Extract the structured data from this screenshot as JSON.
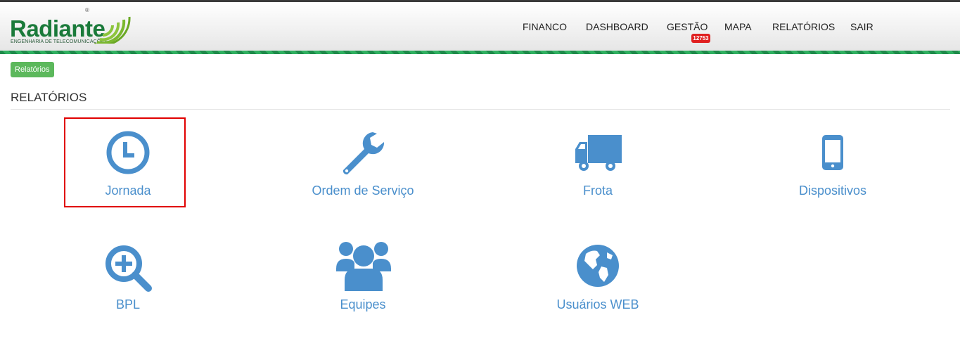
{
  "brand": {
    "name": "Radiante",
    "subtitle": "ENGENHARIA DE TELECOMUNICAÇÕES",
    "registered": "®",
    "color": "#1a7a3a"
  },
  "nav": {
    "items": [
      {
        "label": "FINANCO"
      },
      {
        "label": "DASHBOARD"
      },
      {
        "label": "GESTÃO",
        "badge": "12753"
      },
      {
        "label": "MAPA"
      },
      {
        "label": "RELATÓRIOS"
      },
      {
        "label": "SAIR"
      }
    ]
  },
  "breadcrumb": {
    "label": "Relatórios"
  },
  "page": {
    "title": "RELATÓRIOS"
  },
  "tiles": [
    {
      "label": "Jornada",
      "icon": "clock-icon"
    },
    {
      "label": "Ordem de Serviço",
      "icon": "wrench-icon"
    },
    {
      "label": "Frota",
      "icon": "truck-icon"
    },
    {
      "label": "Dispositivos",
      "icon": "mobile-icon"
    },
    {
      "label": "BPL",
      "icon": "zoom-in-icon"
    },
    {
      "label": "Equipes",
      "icon": "users-icon"
    },
    {
      "label": "Usuários WEB",
      "icon": "globe-icon"
    }
  ],
  "colors": {
    "accent": "#4a8fcc",
    "highlight": "#e00000",
    "badge": "#e02020",
    "breadcrumb": "#5cb85c"
  }
}
